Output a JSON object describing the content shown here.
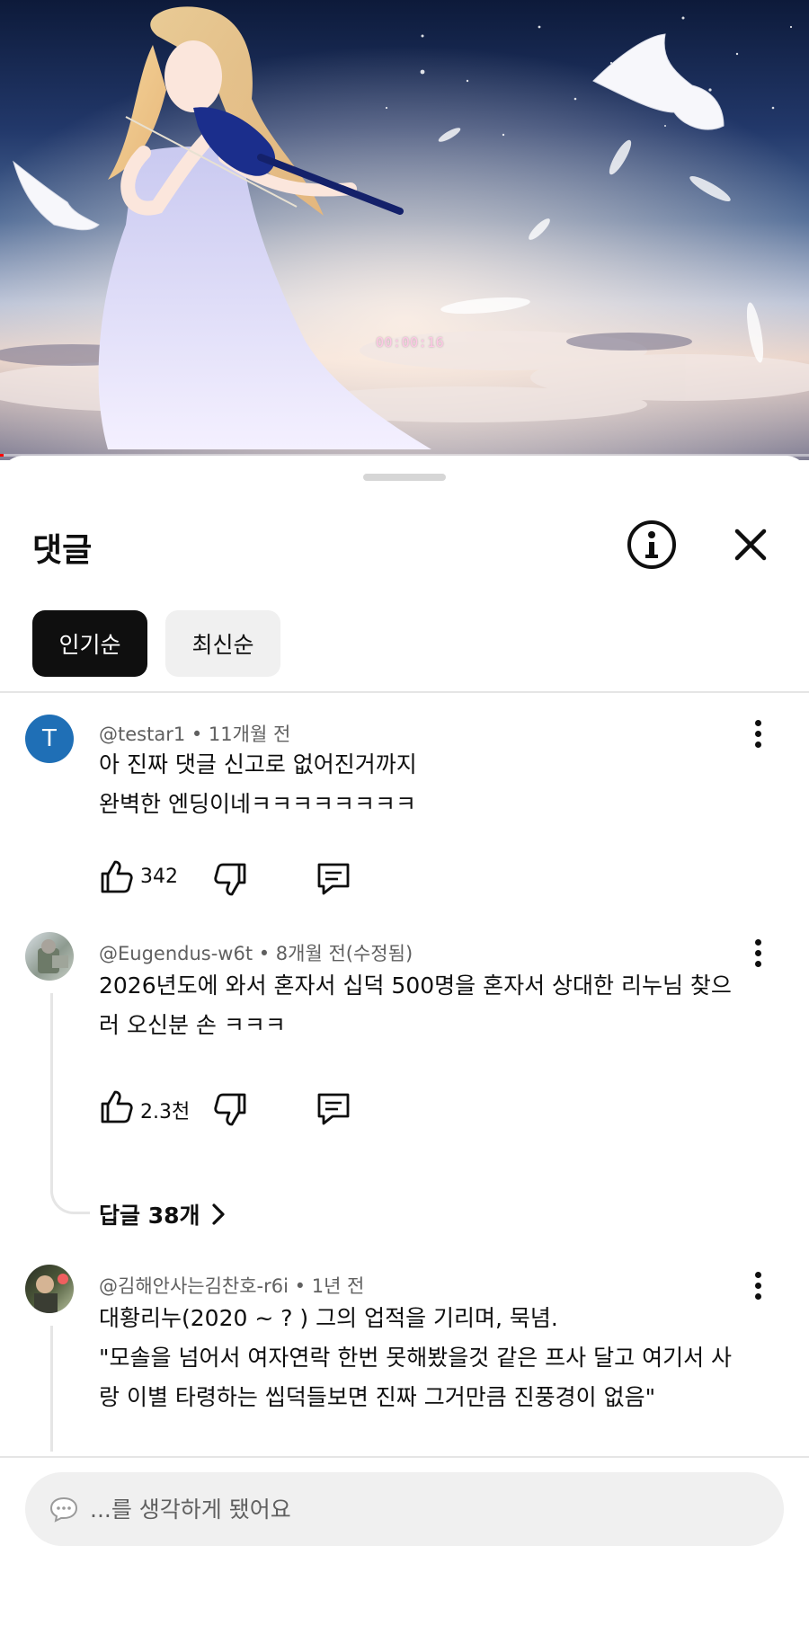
{
  "video": {
    "timestamp": "00:00:16",
    "progress_fraction": 0.004
  },
  "sheet": {
    "title": "댓글",
    "info_icon": "info-circle-icon",
    "close_icon": "close-icon"
  },
  "sort_chips": [
    {
      "label": "인기순",
      "selected": true
    },
    {
      "label": "최신순",
      "selected": false
    }
  ],
  "comments": [
    {
      "avatar_letter": "T",
      "avatar_color": "#1f6fb6",
      "meta": "@testar1 • 11개월 전",
      "lines": [
        "아 진짜 댓글 신고로 없어진거까지",
        "완벽한 엔딩이네ㅋㅋㅋㅋㅋㅋㅋㅋ"
      ],
      "likes": "342"
    },
    {
      "meta": "@Eugendus-w6t • 8개월 전(수정됨)",
      "lines": [
        "2026년도에 와서 혼자서 십덕 500명을 혼자서 상대한 리누님 찾으",
        "러 오신분 손 ㅋㅋㅋ"
      ],
      "likes": "2.3천",
      "replies_label": "답글 38개"
    },
    {
      "meta": "@김해안사는김찬호-r6i • 1년 전",
      "lines": [
        "대황리누(2020 ~ ? ) 그의 업적을 기리며, 묵념.",
        "\"모솔을 넘어서 여자연락 한번 못해봤을것 같은 프사 달고 여기서 사",
        "랑 이별 타령하는 씹덕들보면 진짜 그거만큼 진풍경이 없음\""
      ]
    }
  ],
  "input": {
    "placeholder": "...를 생각하게 됐어요"
  },
  "colors": {
    "accent": "#0f0f0f",
    "muted_text": "#606060",
    "chip_bg": "#f0f0f0",
    "progress": "#ff0000"
  }
}
